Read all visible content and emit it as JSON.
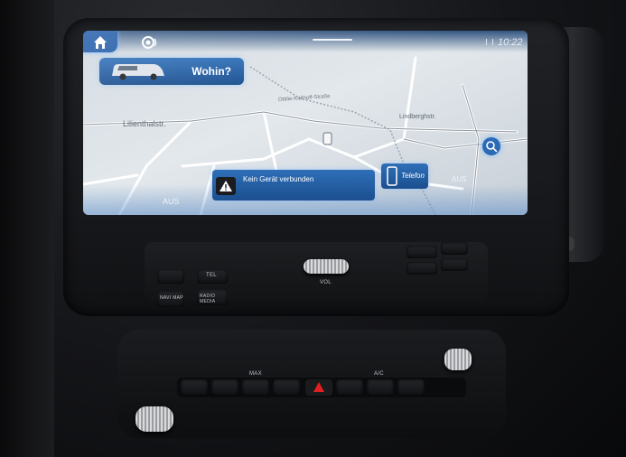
{
  "screen": {
    "home_icon": "home-icon",
    "voice_icon": "voice-assistant-icon",
    "clock": "10:22",
    "signal_icon": "signal-icon",
    "destination_button": {
      "label": "Wohin?",
      "vehicle_icon": "van-icon"
    },
    "streets": [
      "Lilienthalstr.",
      "Lindberghstr.",
      "Ottilie-Kalthoff-Straße"
    ],
    "notification": {
      "icon": "warning-icon",
      "text": "Kein Gerät verbunden"
    },
    "phone_button": {
      "label": "Telefon",
      "icon": "phone-icon"
    },
    "left_label": "AUS",
    "right_label": "AUS",
    "map_options_icon": "map-settings-icon"
  },
  "controls": {
    "tel_label": "TEL",
    "navi_label": "NAVI MAP",
    "radio_label": "RADIO MEDIA",
    "vol_label": "VOL",
    "colors": {
      "screen_accent": "#2e6fb8",
      "hazard": "#e02020"
    }
  },
  "climate": {
    "ac_label": "A/C",
    "defrost_label": "MAX"
  }
}
